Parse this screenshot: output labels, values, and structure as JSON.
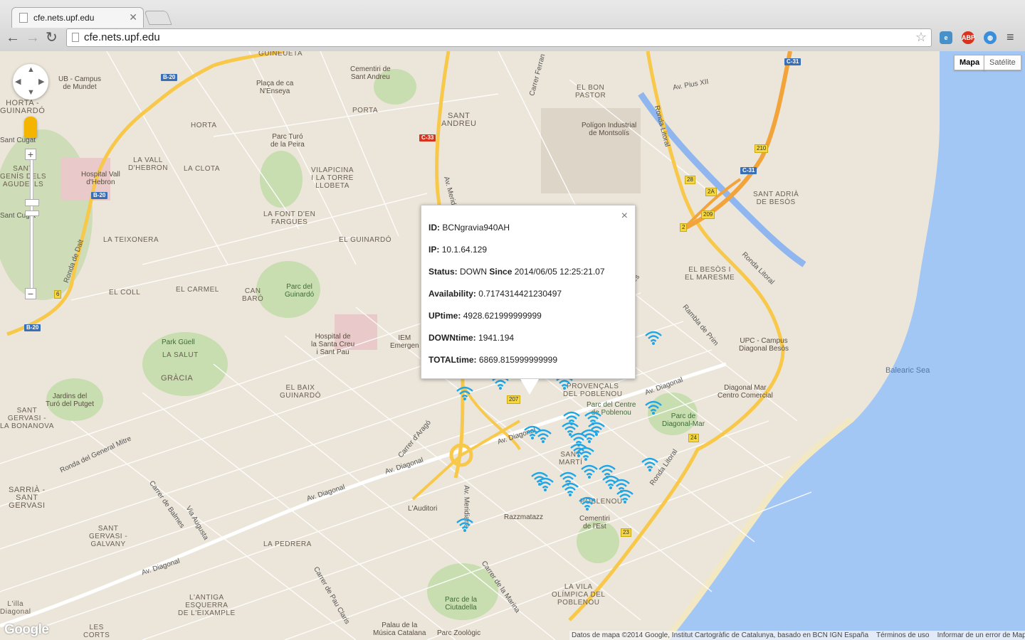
{
  "browser": {
    "tab_title": "cfe.nets.upf.edu",
    "url": "cfe.nets.upf.edu",
    "extensions": [
      "ie-tab",
      "ABP",
      "globe"
    ]
  },
  "map_controls": {
    "map_type": "Mapa",
    "satellite_type": "Satélite",
    "zoom_in": "+",
    "zoom_out": "−"
  },
  "map_labels": {
    "guineueta": "GUINEUETA",
    "cementiri_sant_andreu": "Cementiri de\nSant Andreu",
    "ub_mundet": "UB - Campus\nde Mundet",
    "placa_enseya": "Plaça de ca\nN'Enseya",
    "porta": "PORTA",
    "sant_andreu": "SANT\nANDREU",
    "el_bon_pastor": "EL BON\nPASTOR",
    "poligon": "Polígon Industrial\nde Montsolís",
    "horta": "HORTA",
    "parc_turo_peira": "Parc Turó\nde la Peira",
    "vall_hebron": "LA VALL\nD'HEBRON",
    "la_clota": "LA CLOTA",
    "hospital_vall": "Hospital Vall\nd'Hebron",
    "vilapicina": "VILAPICINA\nI LA TORRE\nLLOBETA",
    "la_font_den_fargues": "LA FONT D'EN\nFARGUES",
    "el_guinardo": "EL GUINARDÓ",
    "la_teixonera": "LA TEIXONERA",
    "el_coll": "EL COLL",
    "el_carmel": "EL CARMEL",
    "can_baro": "CAN\nBARÓ",
    "parc_guinardo": "Parc del\nGuinardó",
    "hospital_sant_pau": "Hospital de\nla Santa Creu\ni Sant Pau",
    "park_guell": "Park Güell",
    "la_salut": "LA SALUT",
    "gracia": "GRÀCIA",
    "el_baix_guinardo": "EL BAIX\nGUINARDÓ",
    "jardins_turo_putget": "Jardins del\nTuró del Putget",
    "sarria": "SARRIÀ -\nSANT\nGERVASI",
    "la_pedrera": "LA PEDRERA",
    "lauditori": "L'Auditori",
    "razzmatazz": "Razzmatazz",
    "cementiri_est": "Cementiri\nde l'Est",
    "parc_ciutadella": "Parc de la\nCiutadella",
    "palau_musica": "Palau de la\nMúsica Catalana",
    "parc_zoologic": "Parc Zoològic",
    "antiga_esquerra": "L'ANTIGA\nESQUERRA\nDE L'EIXAMPLE",
    "parc_centre_poblenou": "Parc del Centre\nde Poblenou",
    "parc_diagonal_mar": "Parc de\nDiagonal-Mar",
    "diagonal_mar_cc": "Diagonal Mar\nCentro Comercial",
    "upc_besos": "UPC - Campus\nDiagonal Besòs",
    "sant_adria": "SANT ADRIÀ\nDE BESÒS",
    "el_besos": "EL BESÒS I\nEL MARESME",
    "vila_olimpica": "LA VILA\nOLÍMPICA DEL\nPOBLENOU",
    "balearic_sea": "Balearic Sea",
    "ronda_dalt": "Ronda de Dalt",
    "ronda_litoral": "Ronda Litoral",
    "ronda_litoral2": "Ronda Litoral",
    "ronda_litoral3": "Ronda Litoral",
    "av_diagonal": "Av. Diagonal",
    "av_diagonal2": "Av. Diagonal",
    "av_diagonal3": "Av. Diagonal",
    "av_diagonal4": "Av. Diagonal",
    "av_diagonal5": "Av. Diagonal",
    "av_meridiana": "Av. Meridiana",
    "av_meridiana2": "Av. Meridiana",
    "via_augusta": "Via Augusta",
    "carrer_balmes": "Carrer de Balmes",
    "carrer_arago": "Carrer d'Aragó",
    "carrer_pau_claris": "Carrer de Pau Claris",
    "carrer_marina": "Carrer de la Marina",
    "ronda_mitre": "Ronda del General Mitre",
    "rambla_prim": "Rambla de Prim",
    "av_pius": "Av. Pius XII",
    "carrer_ferran": "Carrer Ferran",
    "iem": "IEM\nEmergen",
    "poblenou": "POBLENOU",
    "provencals": "PROVENÇALS\nDEL POBLENOU",
    "sant_marti": "SANT\nMARTÍ",
    "sant_gervasi_galvany": "SANT\nGERVASI -\nGALVANY",
    "la_bonanova": "SANT\nGERVASI -\nLA BONANOVA",
    "horta_guinardo": "HORTA -\nGUINARDÓ",
    "sant_genis": "SANT\nGENÍS DELS\nAGUDELLS",
    "les_corts": "LES\nCORTS",
    "la_illa": "L'illa\nDiagonal",
    "sant_cugat": "Sant Cugat",
    "sant_cugat2": "Sant Cugat",
    "lines": "lines"
  },
  "road_shields": {
    "b20a": "B-20",
    "b20b": "B-20",
    "b20c": "B-20",
    "c33": "C-33",
    "c31a": "C-31",
    "c31b": "C-31",
    "n210": "210",
    "n28": "28",
    "n2a": "2A",
    "n209": "209",
    "n2": "2",
    "n207": "207",
    "n24": "24",
    "n23": "23",
    "n6": "6"
  },
  "infowindow": {
    "id_label": "ID:",
    "id_value": "BCNgravia940AH",
    "ip_label": "IP:",
    "ip_value": "10.1.64.129",
    "status_label": "Status:",
    "status_value": "DOWN",
    "since_label": "Since",
    "since_value": "2014/06/05 12:25:21.07",
    "availability_label": "Availability:",
    "availability_value": "0.7174314421230497",
    "uptime_label": "UPtime:",
    "uptime_value": "4928.621999999999",
    "downtime_label": "DOWNtime:",
    "downtime_value": "1941.194",
    "totaltime_label": "TOTALtime:",
    "totaltime_value": "6869.815999999999",
    "close": "×"
  },
  "footer": {
    "attribution": "Datos de mapa ©2014 Google, Institut Cartogràfic de Catalunya, basado en BCN IGN España",
    "terms": "Términos de uso",
    "report": "Informar de un error de Maps",
    "logo": "Google"
  },
  "colors": {
    "water": "#a3c7f5",
    "land": "#ece6da",
    "highway": "#f7c84a",
    "motorway": "#f2a33a",
    "park": "#c8deb0",
    "wifi": "#1ea6e6"
  }
}
